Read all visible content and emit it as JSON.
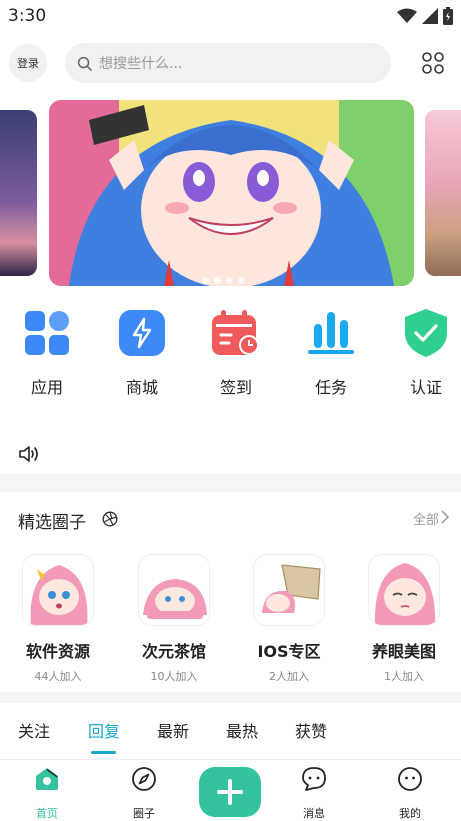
{
  "status": {
    "time": "3:30"
  },
  "header": {
    "login_label": "登录",
    "search_placeholder": "想搜些什么..."
  },
  "quick_actions": [
    {
      "label": "应用",
      "icon": "apps-grid-icon",
      "color": "#3d8af7"
    },
    {
      "label": "商城",
      "icon": "lightning-icon",
      "color": "#3d8af7"
    },
    {
      "label": "签到",
      "icon": "calendar-clock-icon",
      "color": "#f05a5a"
    },
    {
      "label": "任务",
      "icon": "bar-chart-icon",
      "color": "#1aa9f0"
    },
    {
      "label": "认证",
      "icon": "shield-check-icon",
      "color": "#2fcf8f"
    }
  ],
  "circles": {
    "title": "精选圈子",
    "all_label": "全部",
    "items": [
      {
        "name": "软件资源",
        "count": "44人加入"
      },
      {
        "name": "次元茶馆",
        "count": "10人加入"
      },
      {
        "name": "IOS专区",
        "count": "2人加入"
      },
      {
        "name": "养眼美图",
        "count": "1人加入"
      }
    ]
  },
  "feed_tabs": [
    "关注",
    "回复",
    "最新",
    "最热",
    "获赞"
  ],
  "active_feed_tab": "回复",
  "bottom_nav": [
    {
      "label": "首页",
      "icon": "home-icon"
    },
    {
      "label": "圈子",
      "icon": "compass-icon"
    },
    {
      "label": "消息",
      "icon": "chat-icon"
    },
    {
      "label": "我的",
      "icon": "profile-icon"
    }
  ],
  "colors": {
    "accent": "#1aa7c9",
    "fab": "#35c29f",
    "home_active": "#2fbf9b"
  }
}
